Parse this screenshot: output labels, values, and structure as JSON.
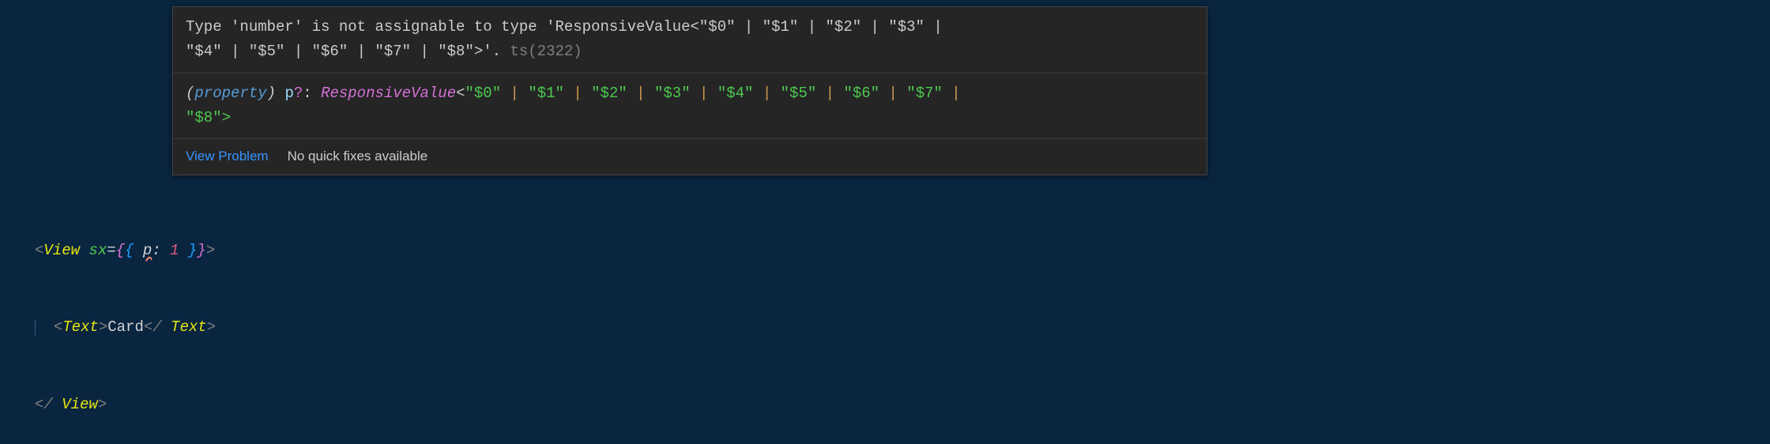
{
  "tooltip": {
    "error_line1": "Type 'number' is not assignable to type 'ResponsiveValue<\"$0\" | \"$1\" | \"$2\" | \"$3\" |",
    "error_line2": "\"$4\" | \"$5\" | \"$6\" | \"$7\" | \"$8\">'.",
    "error_code": " ts(2322)",
    "sig": {
      "open_paren": "(",
      "kw": "property",
      "close_paren": ") ",
      "prop": "p",
      "opt": "?",
      "colon": ": ",
      "type": "ResponsiveValue",
      "lt": "<",
      "values": [
        "\"$0\"",
        "\"$1\"",
        "\"$2\"",
        "\"$3\"",
        "\"$4\"",
        "\"$5\"",
        "\"$6\"",
        "\"$7\"",
        "\"$8\""
      ],
      "pipe": " | ",
      "gt": ">"
    },
    "view_problem": "View Problem",
    "no_fixes": "No quick fixes available"
  },
  "code": {
    "line1": {
      "lt": "<",
      "tag": "View",
      "sp": " ",
      "attr": "sx",
      "eq": "=",
      "bo1": "{",
      "bo2": "{ ",
      "prop": "p",
      "col": ": ",
      "num": "1",
      "bc2": " }",
      "bc1": "}",
      "gt": ">"
    },
    "line2": {
      "indent": "  ",
      "lt": "<",
      "tag": "Text",
      "gt": ">",
      "text": "Card",
      "clt": "</",
      "ctag": " Text",
      "cgt": ">"
    },
    "line3": {
      "clt": "</",
      "ctag": " View",
      "cgt": ">"
    }
  }
}
